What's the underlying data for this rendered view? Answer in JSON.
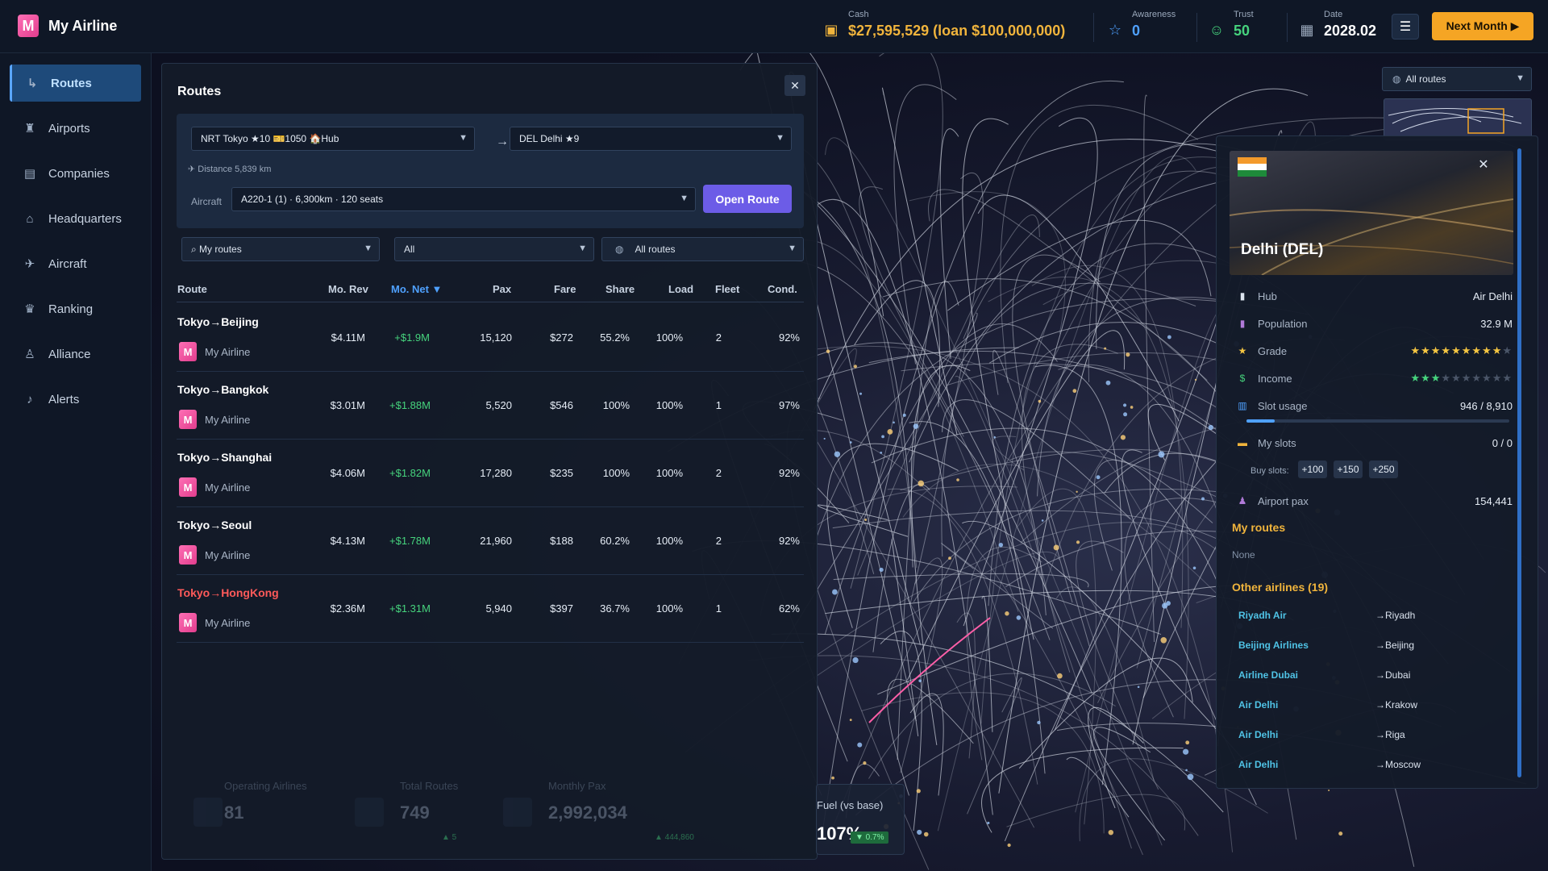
{
  "app": {
    "title": "My Airline",
    "logo_letter": "M"
  },
  "topbar": {
    "cash_label": "Cash",
    "cash_value": "$27,595,529 (loan $100,000,000)",
    "awareness_label": "Awareness",
    "awareness_value": "0",
    "trust_label": "Trust",
    "trust_value": "50",
    "date_label": "Date",
    "date_value": "2028.02",
    "next_label": "Next Month ▶"
  },
  "sidebar": {
    "items": [
      {
        "label": "Routes",
        "icon": "routes-icon"
      },
      {
        "label": "Airports",
        "icon": "airport-tower-icon"
      },
      {
        "label": "Companies",
        "icon": "building-icon"
      },
      {
        "label": "Headquarters",
        "icon": "home-icon"
      },
      {
        "label": "Aircraft",
        "icon": "plane-icon"
      },
      {
        "label": "Ranking",
        "icon": "trophy-icon"
      },
      {
        "label": "Alliance",
        "icon": "user-icon"
      },
      {
        "label": "Alerts",
        "icon": "bell-icon"
      }
    ]
  },
  "panel": {
    "title": "Routes",
    "origin": "NRT Tokyo ★10 🎫1050 🏠Hub",
    "destination": "DEL Delhi ★9",
    "distance": "✈ Distance 5,839 km",
    "aircraft_label": "Aircraft",
    "aircraft_value": "A220-1 (1) · 6,300km · 120 seats",
    "open_route": "Open Route",
    "filter_owner": "⌕ My routes",
    "filter_type": "All",
    "filter_scope": "All routes",
    "columns": [
      "Route",
      "Mo. Rev",
      "Mo. Net ▼",
      "Pax",
      "Fare",
      "Share",
      "Load",
      "Fleet",
      "Cond."
    ],
    "rows": [
      {
        "route": "Tokyo→Beijing",
        "airline": "My Airline",
        "rev": "$4.11M",
        "net": "+$1.9M",
        "pax": "15,120",
        "fare": "$272",
        "share": "55.2%",
        "load": "100%",
        "fleet": "2",
        "cond": "92%"
      },
      {
        "route": "Tokyo→Bangkok",
        "airline": "My Airline",
        "rev": "$3.01M",
        "net": "+$1.88M",
        "pax": "5,520",
        "fare": "$546",
        "share": "100%",
        "load": "100%",
        "fleet": "1",
        "cond": "97%"
      },
      {
        "route": "Tokyo→Shanghai",
        "airline": "My Airline",
        "rev": "$4.06M",
        "net": "+$1.82M",
        "pax": "17,280",
        "fare": "$235",
        "share": "100%",
        "load": "100%",
        "fleet": "2",
        "cond": "92%"
      },
      {
        "route": "Tokyo→Seoul",
        "airline": "My Airline",
        "rev": "$4.13M",
        "net": "+$1.78M",
        "pax": "21,960",
        "fare": "$188",
        "share": "60.2%",
        "load": "100%",
        "fleet": "2",
        "cond": "92%"
      },
      {
        "route": "Tokyo→HongKong",
        "airline": "My Airline",
        "rev": "$2.36M",
        "net": "+$1.31M",
        "pax": "5,940",
        "fare": "$397",
        "share": "36.7%",
        "load": "100%",
        "fleet": "1",
        "cond": "62%"
      }
    ]
  },
  "footer_stats": {
    "operating_label": "Operating Airlines",
    "operating_value": "81",
    "routes_label": "Total Routes",
    "routes_value": "749",
    "routes_delta": "▲ 5",
    "pax_label": "Monthly Pax",
    "pax_value": "2,992,034",
    "pax_delta": "▲ 444,860",
    "fuel_label": "Fuel (vs base)",
    "fuel_value": "107%",
    "fuel_delta": "▼ 0.7%"
  },
  "map_controls": {
    "scope": "All routes"
  },
  "airport_card": {
    "title": "Delhi (DEL)",
    "hub_label": "Hub",
    "hub_value": "Air Delhi",
    "population_label": "Population",
    "population_value": "32.9 M",
    "grade_label": "Grade",
    "grade_stars": 9,
    "grade_max": 10,
    "income_label": "Income",
    "income_stars": 3,
    "income_max": 10,
    "slot_label": "Slot usage",
    "slot_value": "946 / 8,910",
    "slot_fraction": 0.106,
    "myslots_label": "My slots",
    "myslots_value": "0 / 0",
    "buy_label": "Buy slots:",
    "buy_options": [
      "+100",
      "+150",
      "+250"
    ],
    "pax_label": "Airport pax",
    "pax_value": "154,441",
    "my_routes_heading": "My routes",
    "my_routes_none": "None",
    "other_heading": "Other airlines (19)",
    "other_airlines": [
      {
        "name": "Riyadh Air",
        "dest": "→Riyadh"
      },
      {
        "name": "Beijing Airlines",
        "dest": "→Beijing"
      },
      {
        "name": "Airline Dubai",
        "dest": "→Dubai"
      },
      {
        "name": "Air Delhi",
        "dest": "→Krakow"
      },
      {
        "name": "Air Delhi",
        "dest": "→Riga"
      },
      {
        "name": "Air Delhi",
        "dest": "→Moscow"
      }
    ]
  },
  "colors": {
    "accent": "#5aa6ff",
    "gold": "#f0b43c",
    "green": "#46d37d",
    "purple": "#6c5ce7",
    "orange": "#f5a524"
  }
}
